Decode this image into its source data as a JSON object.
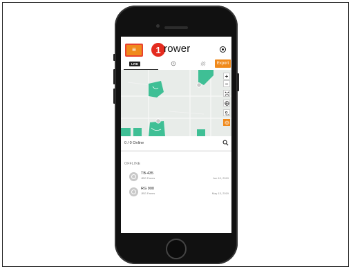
{
  "step": {
    "number": "1"
  },
  "app": {
    "title": "rower",
    "menu_icon": "≡"
  },
  "tabs": {
    "live_label": "LIVE",
    "export_label": "Export"
  },
  "map_tools": {
    "zoom_in": "+",
    "zoom_out": "−"
  },
  "online": {
    "status": "0 / 0 Online"
  },
  "devices": {
    "section_title": "OFFLINE",
    "items": [
      {
        "name": "TB-435",
        "farm": "JBG Farms",
        "date": "Jun 10, 2019"
      },
      {
        "name": "RG 900",
        "farm": "JBG Farms",
        "date": "May 13, 2019"
      }
    ]
  },
  "colors": {
    "accent": "#f08a1c",
    "highlight": "#e42b1f",
    "field": "#3fbf95"
  }
}
